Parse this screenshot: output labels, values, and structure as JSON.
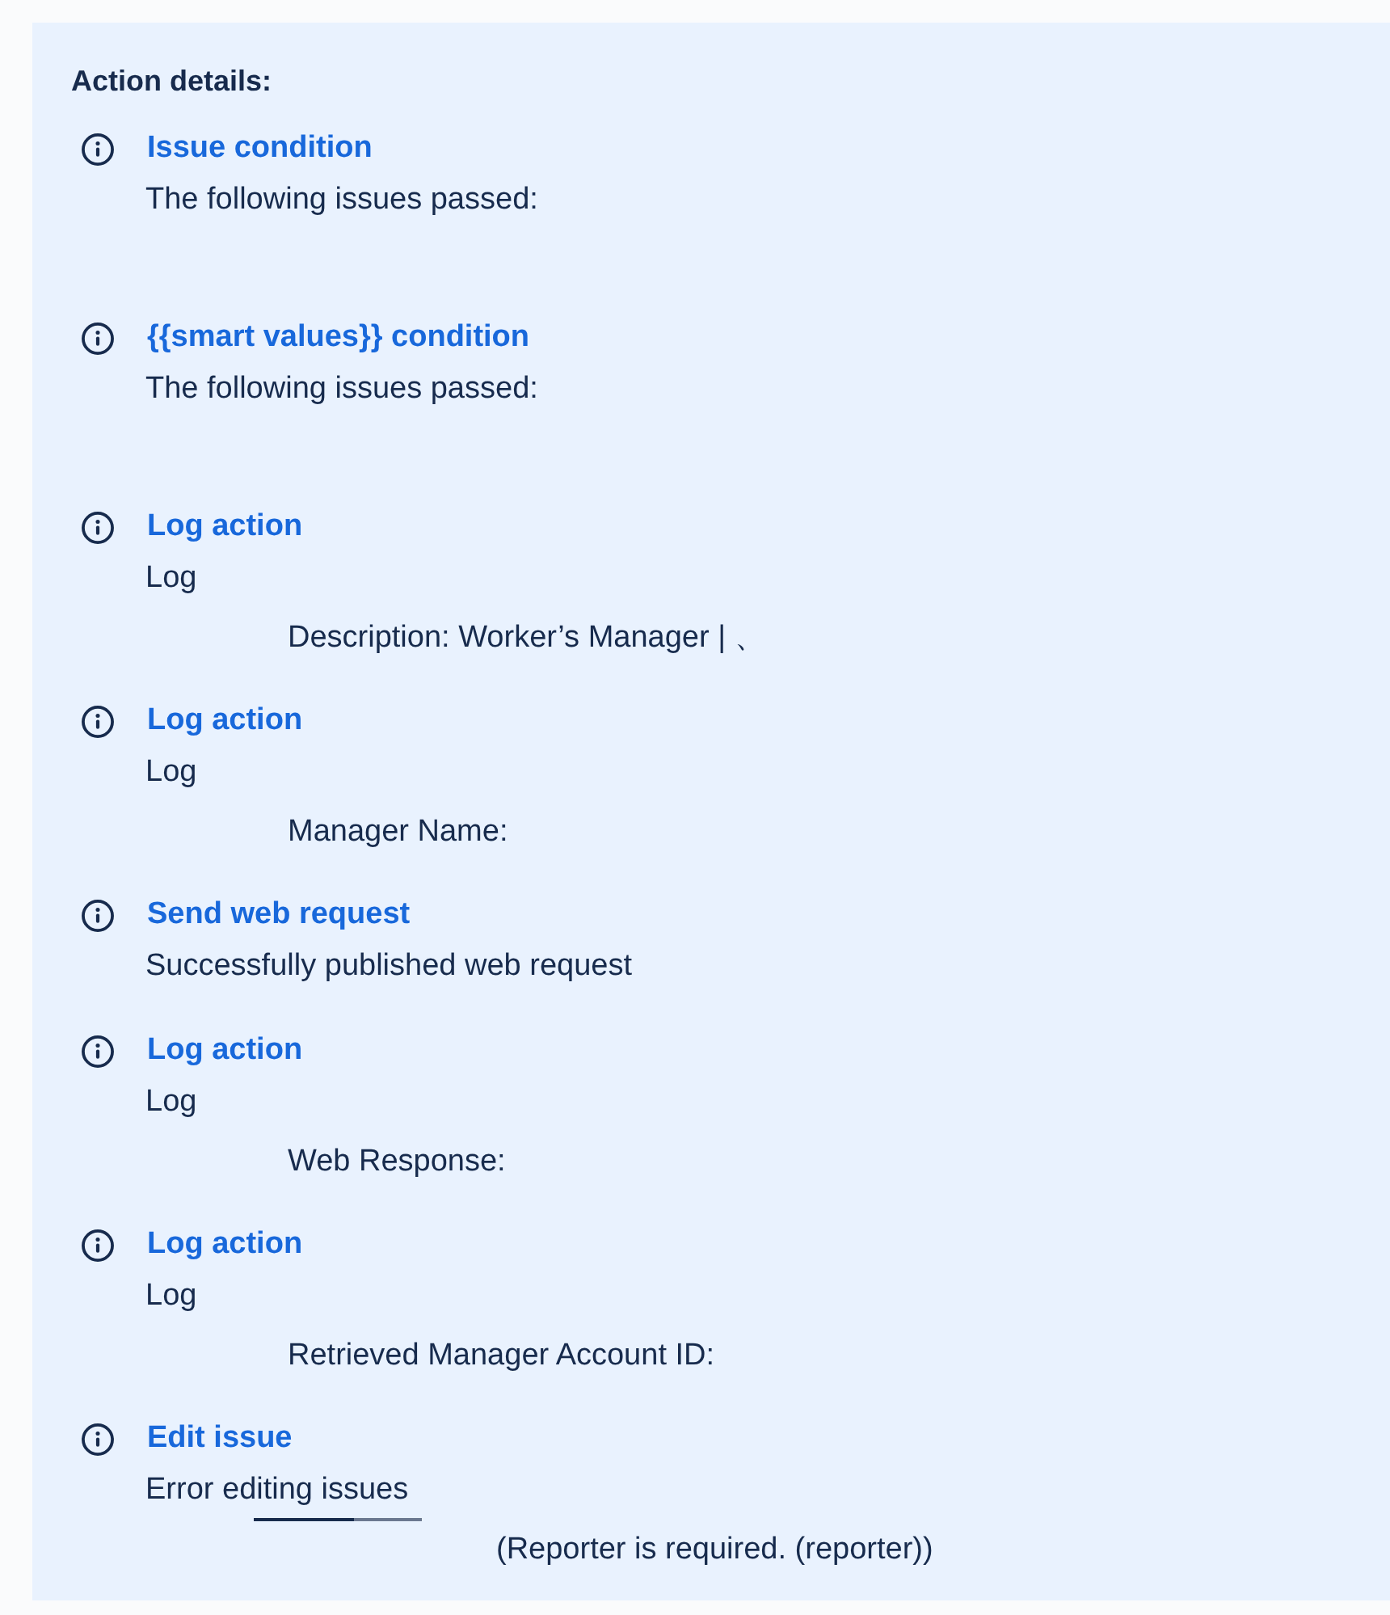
{
  "panel": {
    "heading": "Action details:",
    "entries": [
      {
        "kind": "condition",
        "title": "Issue condition",
        "message": "The following issues passed:"
      },
      {
        "kind": "condition",
        "title": "{{smart values}} condition",
        "message": "The following issues passed:"
      },
      {
        "kind": "log",
        "title": "Log action",
        "message": "Log",
        "detail": "Description: Worker’s Manager | 、"
      },
      {
        "kind": "log",
        "title": "Log action",
        "message": "Log",
        "detail": "Manager Name:"
      },
      {
        "kind": "web",
        "title": "Send web request",
        "message": "Successfully published web request"
      },
      {
        "kind": "log",
        "title": "Log action",
        "message": "Log",
        "detail": "Web Response:"
      },
      {
        "kind": "log",
        "title": "Log action",
        "message": "Log",
        "detail": "Retrieved Manager Account ID:"
      },
      {
        "kind": "error",
        "title": "Edit issue",
        "message": "Error editing issues",
        "detail": "(Reporter is required. (reporter))"
      }
    ]
  }
}
